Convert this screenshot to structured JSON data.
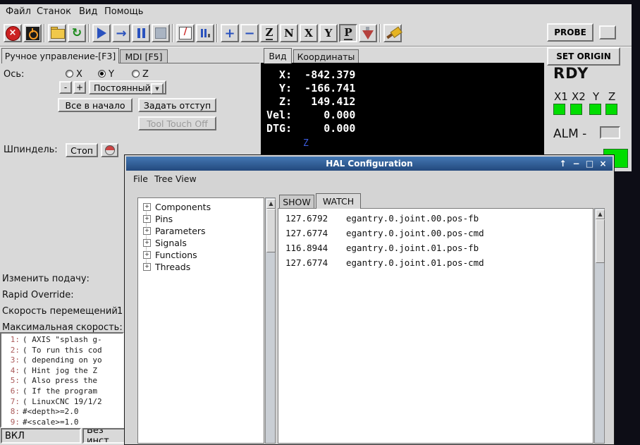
{
  "colors": {
    "window_bg": "#d9d9d9",
    "desktop": "#0d0d16",
    "title_bar_blue": "#3f6fae",
    "lamp_green": "#00dd00",
    "dro_bg": "#000000",
    "dro_text": "#ffffff",
    "estop_red": "#cc2222",
    "icon_blue": "#2a52be"
  },
  "menu": {
    "items": [
      "Файл",
      "Станок",
      "Вид",
      "Помощь"
    ]
  },
  "toolbar": {
    "probe_label": "PROBE",
    "set_origin_label": "SET ORIGIN",
    "icons": {
      "estop": "×",
      "reload": "↻",
      "step": "→",
      "skip": "/",
      "zoom_in": "+",
      "zoom_out": "−",
      "view_z": "Z",
      "view_z_rot": "N",
      "view_x": "X",
      "view_y": "Y",
      "view_p": "P"
    }
  },
  "manual": {
    "tab_manual": "Ручное управление-[F3]",
    "tab_mdi": "MDI [F5]",
    "axis_label": "Ось:",
    "axes": [
      "X",
      "Y",
      "Z"
    ],
    "selected_axis": "Y",
    "jog_minus": "-",
    "jog_plus": "+",
    "jog_mode": "Постоянный",
    "jog_mode_arrow": "▼",
    "home_all": "Все в начало",
    "touch_off": "Задать отступ",
    "tool_touch_off": "Tool Touch Off",
    "spindle_label": "Шпиндель:",
    "spindle_stop": "Стоп"
  },
  "preview": {
    "tab_view": "Вид",
    "tab_dro": "Координаты",
    "dro_lines": [
      "  X:  -842.379",
      "  Y:  -166.741",
      "  Z:   149.412",
      "Vel:     0.000",
      "DTG:     0.000"
    ],
    "axis_marker": "Z"
  },
  "vcp": {
    "rdy": "RDY",
    "axis_labels": [
      "X1",
      "X2",
      "Y",
      "Z"
    ],
    "alm_label": "ALM -"
  },
  "overrides": {
    "feed": "Изменить подачу:",
    "rapid": "Rapid Override:",
    "jog": "Скорость перемещений",
    "jog_value": "1",
    "max": "Максимальная скорость:"
  },
  "gcode": {
    "lines": [
      {
        "n": "1:",
        "t": "( AXIS \"splash g-"
      },
      {
        "n": "2:",
        "t": "( To run this cod"
      },
      {
        "n": "3:",
        "t": "( depending on yo"
      },
      {
        "n": "4:",
        "t": "( Hint jog the Z"
      },
      {
        "n": "5:",
        "t": "( Also press the"
      },
      {
        "n": "6:",
        "t": "( If the program"
      },
      {
        "n": "7:",
        "t": "( LinuxCNC 19/1/2"
      },
      {
        "n": "8:",
        "t": "#<depth>=2.0"
      },
      {
        "n": "9:",
        "t": "#<scale>=1.0"
      }
    ]
  },
  "statusbar": {
    "power": "ВКЛ",
    "tool": "Без инст"
  },
  "hal": {
    "title": "HAL Configuration",
    "menu": [
      "File",
      "Tree View"
    ],
    "expander": "+",
    "tree": [
      "Components",
      "Pins",
      "Parameters",
      "Signals",
      "Functions",
      "Threads"
    ],
    "tabs": {
      "show": "SHOW",
      "watch": "WATCH"
    },
    "watch": [
      {
        "value": "127.6792",
        "name": "egantry.0.joint.00.pos-fb"
      },
      {
        "value": "127.6774",
        "name": "egantry.0.joint.00.pos-cmd"
      },
      {
        "value": "116.8944",
        "name": "egantry.0.joint.01.pos-fb"
      },
      {
        "value": "127.6774",
        "name": "egantry.0.joint.01.pos-cmd"
      }
    ],
    "window_buttons": {
      "shade": "↑",
      "minimize": "−",
      "maximize": "□",
      "close": "×"
    },
    "scroll_up_arrow": "▲"
  }
}
